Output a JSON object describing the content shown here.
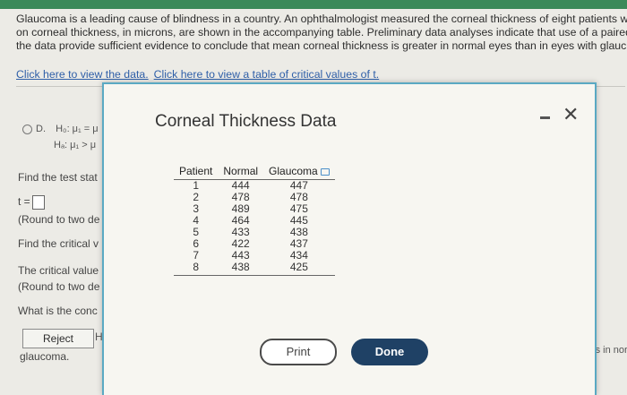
{
  "problem": {
    "lines": [
      "Glaucoma is a leading cause of blindness in a country. An ophthalmologist measured the corneal thickness of eight patients w",
      "on corneal thickness, in microns, are shown in the accompanying table. Preliminary data analyses indicate that use of a paired",
      "the data provide sufficient evidence to conclude that mean corneal thickness is greater in normal eyes than in eyes with glauc"
    ],
    "link_data": "Click here to view the data.",
    "link_table": "Click here to view a table of critical values of t."
  },
  "background": {
    "hyp_prefix": "D.",
    "h0": "H₀: μ₁ = μ",
    "ha": "Hₐ: μ₁ > μ",
    "find_stat": "Find the test stat",
    "t_label": "t =",
    "round1": "(Round to two de",
    "find_critical": "Find the critical v",
    "critical_value": "The critical value",
    "round2": "(Round to two de",
    "what_conc": "What is the conc",
    "reject_label": "Reject",
    "h_frag": "H",
    "glaucoma_frag": "glaucoma.",
    "right_frag": "ess in nor"
  },
  "modal": {
    "title": "Corneal Thickness Data",
    "columns": [
      "Patient",
      "Normal",
      "Glaucoma"
    ],
    "rows": [
      [
        "1",
        "444",
        "447"
      ],
      [
        "2",
        "478",
        "478"
      ],
      [
        "3",
        "489",
        "475"
      ],
      [
        "4",
        "464",
        "445"
      ],
      [
        "5",
        "433",
        "438"
      ],
      [
        "6",
        "422",
        "437"
      ],
      [
        "7",
        "443",
        "434"
      ],
      [
        "8",
        "438",
        "425"
      ]
    ],
    "print_label": "Print",
    "done_label": "Done"
  },
  "colors": {
    "accent": "#5aa9c3",
    "done_bg": "#1f4165",
    "link": "#2f5fa8",
    "topbar": "#3b8a5a"
  }
}
